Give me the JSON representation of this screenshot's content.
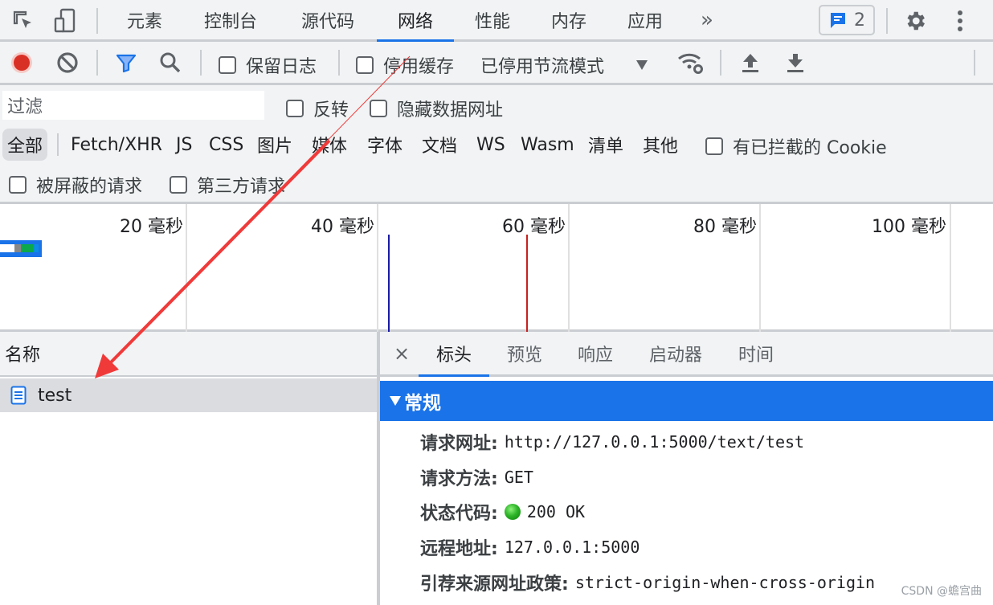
{
  "tabbar": {
    "tabs": [
      {
        "label": "元素"
      },
      {
        "label": "控制台"
      },
      {
        "label": "源代码"
      },
      {
        "label": "网络",
        "active": true
      },
      {
        "label": "性能"
      },
      {
        "label": "内存"
      },
      {
        "label": "应用"
      }
    ],
    "more_label": "»",
    "issues_count": "2"
  },
  "toolbar": {
    "preserve_log": "保留日志",
    "disable_cache": "停用缓存",
    "throttling": "已停用节流模式"
  },
  "filter": {
    "placeholder": "过滤",
    "invert": "反转",
    "hide_data_urls": "隐藏数据网址",
    "types": [
      "全部",
      "Fetch/XHR",
      "JS",
      "CSS",
      "图片",
      "媒体",
      "字体",
      "文档",
      "WS",
      "Wasm",
      "清单",
      "其他"
    ],
    "blocked_cookies": "有已拦截的 Cookie",
    "blocked_requests": "被屏蔽的请求",
    "third_party": "第三方请求"
  },
  "timeline": {
    "ticks": [
      "20 毫秒",
      "40 毫秒",
      "60 毫秒",
      "80 毫秒",
      "100 毫秒"
    ],
    "dom_content_loaded_ms": 43,
    "load_ms": 58
  },
  "request_list": {
    "column_name": "名称",
    "rows": [
      {
        "name": "test",
        "icon": "document-icon"
      }
    ]
  },
  "details": {
    "close": "×",
    "tabs": [
      "标头",
      "预览",
      "响应",
      "启动器",
      "时间"
    ],
    "section_title": "常规",
    "general": [
      {
        "key": "请求网址:",
        "value": "http://127.0.0.1:5000/text/test"
      },
      {
        "key": "请求方法:",
        "value": "GET"
      },
      {
        "key": "状态代码:",
        "value": "200 OK"
      },
      {
        "key": "远程地址:",
        "value": "127.0.0.1:5000"
      },
      {
        "key": "引荐来源网址政策:",
        "value": "strict-origin-when-cross-origin"
      }
    ]
  },
  "watermark": "CSDN @蟾宫曲",
  "colors": {
    "accent": "#1a73e8",
    "record": "#d93025",
    "annotation_arrow": "#f03a3a"
  }
}
